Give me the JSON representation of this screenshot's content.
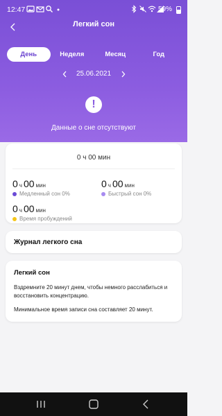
{
  "status_bar": {
    "time": "12:47",
    "battery": "59%",
    "icons": [
      "image-icon",
      "mail-icon",
      "search-icon",
      "dot-icon",
      "bluetooth-icon",
      "mute-icon",
      "wifi-icon",
      "signal-icon",
      "battery-icon"
    ]
  },
  "header": {
    "title": "Легкий сон"
  },
  "tabs": [
    {
      "label": "День",
      "active": true
    },
    {
      "label": "Неделя",
      "active": false
    },
    {
      "label": "Месяц",
      "active": false
    },
    {
      "label": "Год",
      "active": false
    }
  ],
  "date_nav": {
    "date": "25.06.2021"
  },
  "no_data": {
    "message": "Данные о сне отсутствуют"
  },
  "summary": {
    "total": "0 ч 00 мин",
    "light_sleep": {
      "hours": "0",
      "hour_unit": "ч",
      "minutes": "00",
      "minute_unit": "мин",
      "label": "Медленный сон 0%"
    },
    "deep_sleep": {
      "hours": "0",
      "hour_unit": "ч",
      "minutes": "00",
      "minute_unit": "мин",
      "label": "Быстрый сон 0%"
    },
    "awake": {
      "hours": "0",
      "hour_unit": "ч",
      "minutes": "00",
      "minute_unit": "мин",
      "label": "Время пробуждений"
    }
  },
  "journal": {
    "title": "Журнал легкого сна"
  },
  "info": {
    "title": "Легкий сон",
    "paragraph1": "Вздремните 20 минут днем, чтобы немного расслабиться и восстановить концентрацию.",
    "paragraph2": "Минимальное время записи сна составляет 20 минут."
  },
  "colors": {
    "accent": "#7a4fd6",
    "light_dot": "#6b4bd6",
    "deep_dot": "#a78bf0",
    "awake_dot": "#f5c518"
  }
}
